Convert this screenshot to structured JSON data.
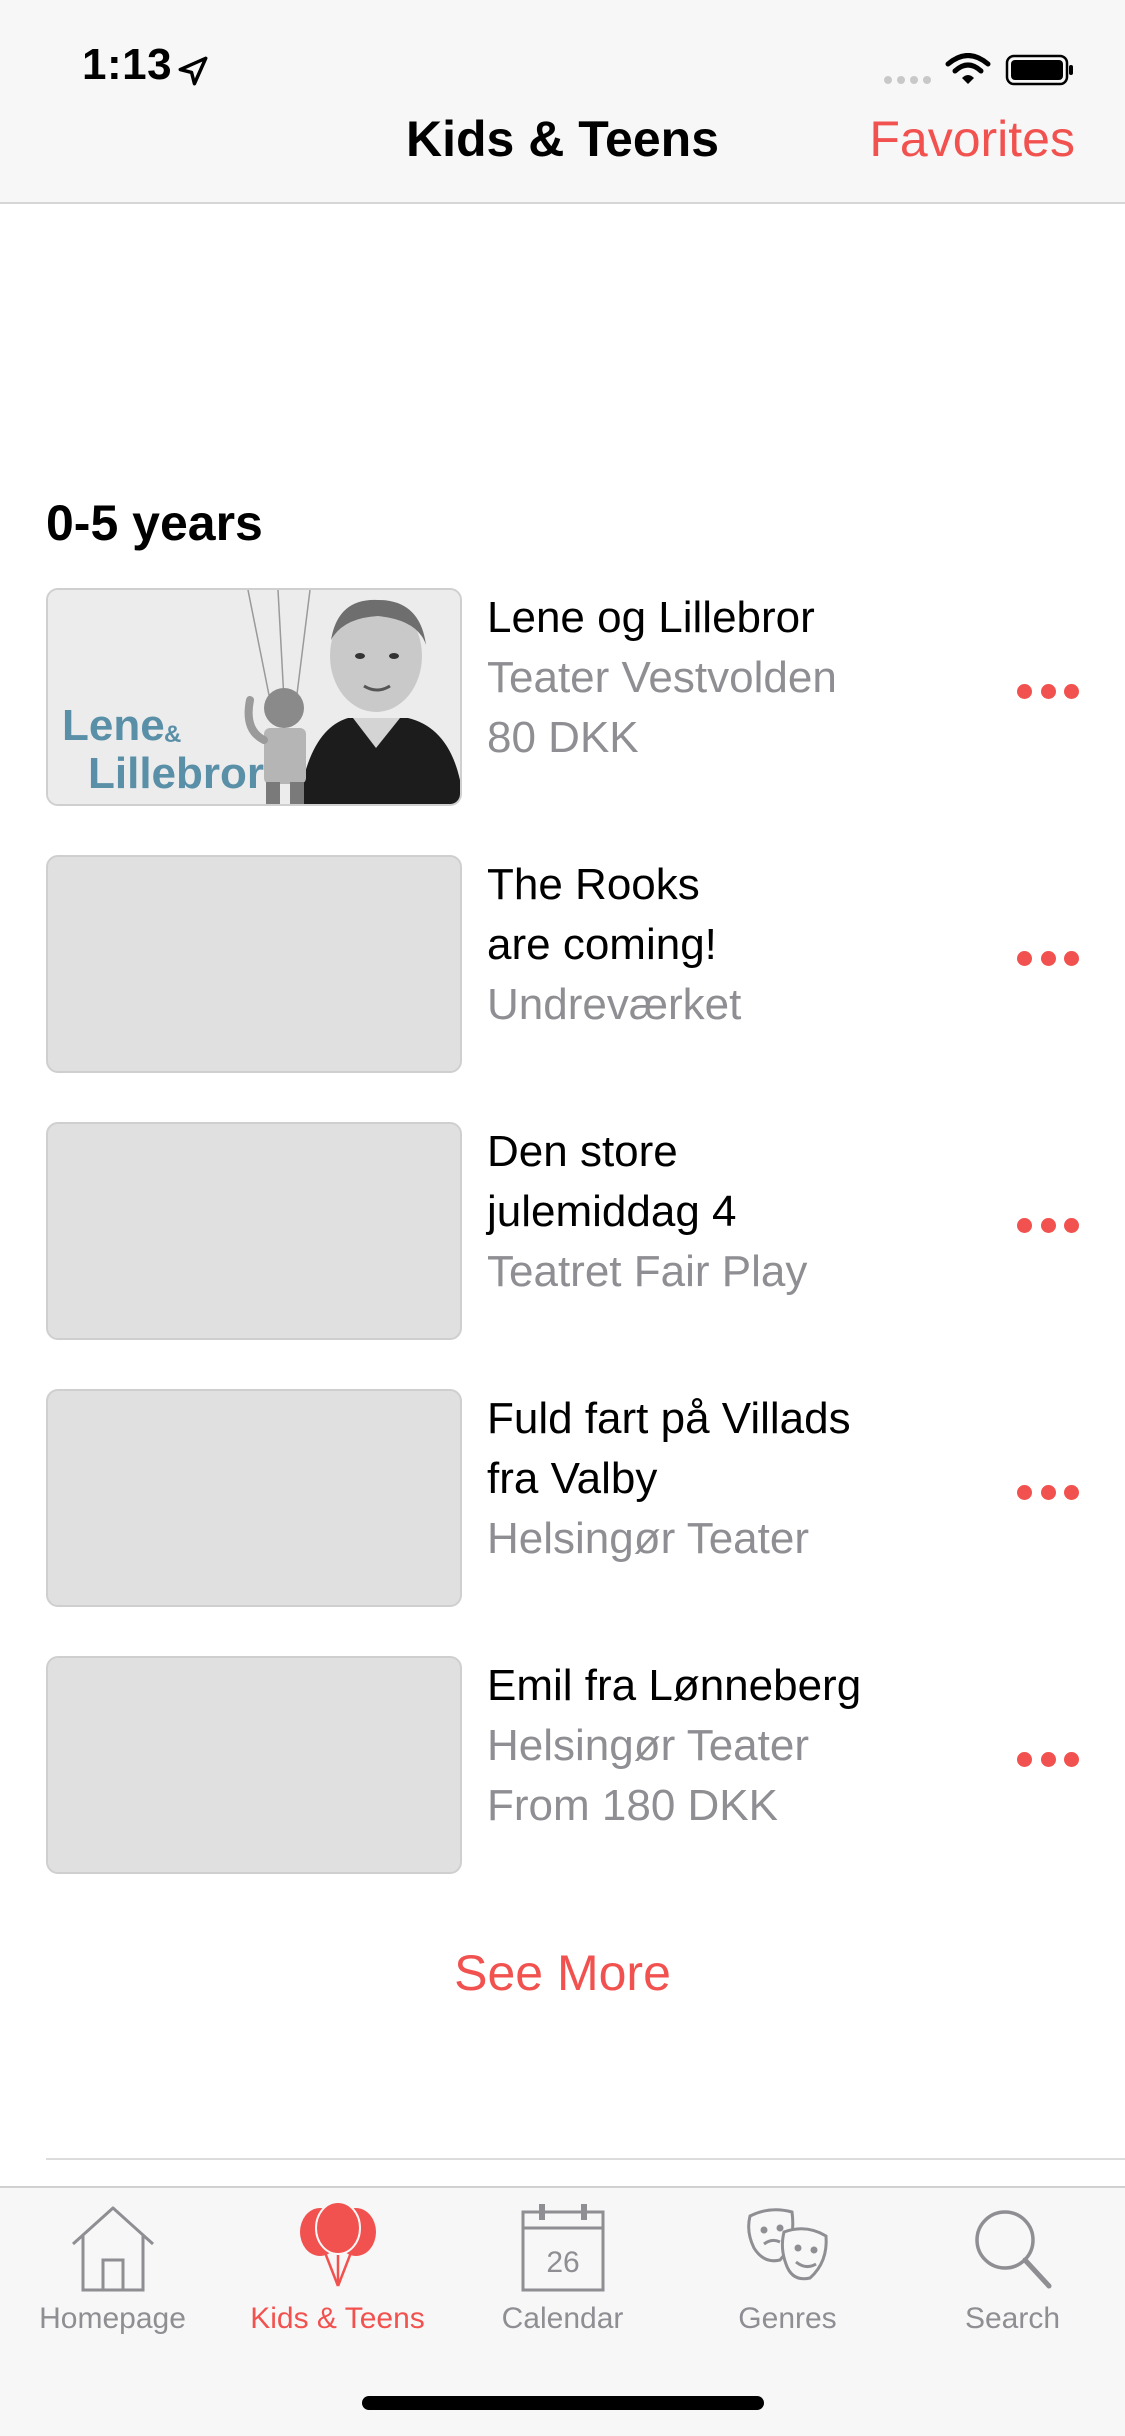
{
  "status_bar": {
    "time": "1:13"
  },
  "nav": {
    "title": "Kids & Teens",
    "favorites": "Favorites"
  },
  "section": {
    "title": "0-5 years"
  },
  "items": [
    {
      "lines": [
        "Lene og Lillebror"
      ],
      "sub_lines": [
        "Teater Vestvolden",
        "80 DKK"
      ],
      "has_image": true,
      "image_text_1": "Lene",
      "image_text_amp": "&",
      "image_text_2": "Lillebror"
    },
    {
      "lines": [
        "The Rooks",
        "are coming!"
      ],
      "sub_lines": [
        "Undreværket"
      ],
      "has_image": false
    },
    {
      "lines": [
        "Den store",
        "julemiddag 4"
      ],
      "sub_lines": [
        "Teatret Fair Play"
      ],
      "has_image": false
    },
    {
      "lines": [
        "Fuld fart på Villads",
        "fra Valby"
      ],
      "sub_lines": [
        "Helsingør Teater"
      ],
      "has_image": false
    },
    {
      "lines": [
        "Emil fra Lønneberg"
      ],
      "sub_lines": [
        "Helsingør Teater",
        "From 180 DKK"
      ],
      "has_image": false
    }
  ],
  "see_more": "See More",
  "tabs": [
    {
      "label": "Homepage",
      "icon": "house-icon",
      "active": false
    },
    {
      "label": "Kids & Teens",
      "icon": "balloons-icon",
      "active": true
    },
    {
      "label": "Calendar",
      "icon": "calendar-icon",
      "active": false,
      "calendar_day": "26"
    },
    {
      "label": "Genres",
      "icon": "theater-masks-icon",
      "active": false
    },
    {
      "label": "Search",
      "icon": "search-icon",
      "active": false
    }
  ],
  "colors": {
    "accent": "#f2524f",
    "secondary_text": "#8e8e93",
    "bar_bg": "#f7f7f7",
    "placeholder": "#e0e0e0"
  }
}
